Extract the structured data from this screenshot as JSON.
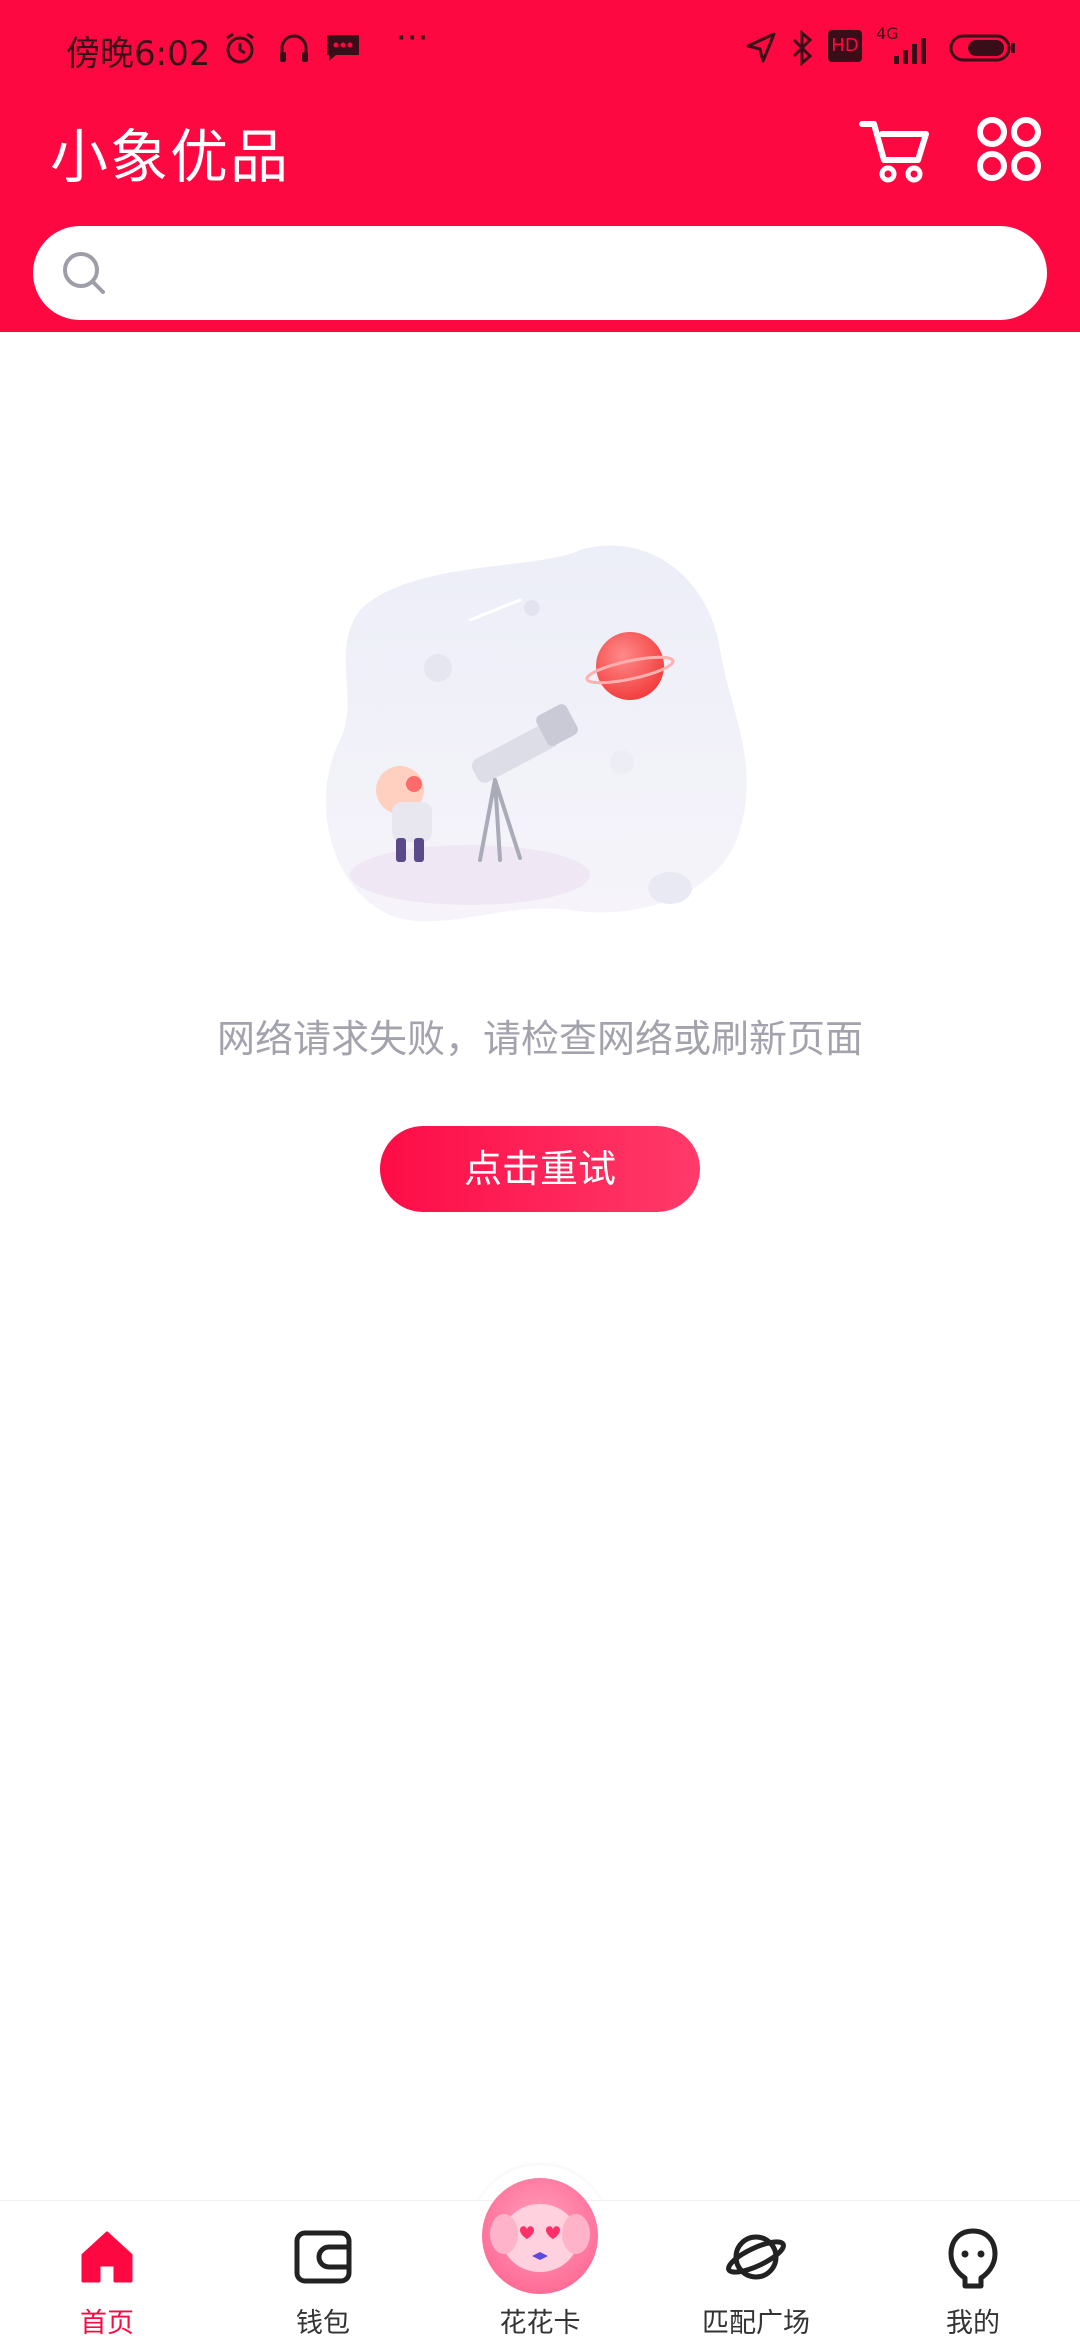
{
  "status_bar": {
    "time": "傍晚6:02",
    "dots": "···",
    "network": "4G",
    "hd": "HD"
  },
  "header": {
    "title": "小象优品",
    "cart_icon": "cart-icon",
    "menu_icon": "grid-menu-icon"
  },
  "search": {
    "placeholder": "",
    "icon": "search-icon"
  },
  "error": {
    "message": "网络请求失败，请检查网络或刷新页面",
    "retry_label": "点击重试"
  },
  "tabs": [
    {
      "label": "首页",
      "icon": "home-icon",
      "active": true
    },
    {
      "label": "钱包",
      "icon": "wallet-icon",
      "active": false
    },
    {
      "label": "花花卡",
      "icon": "mascot-icon",
      "active": false
    },
    {
      "label": "匹配广场",
      "icon": "planet-icon",
      "active": false
    },
    {
      "label": "我的",
      "icon": "profile-icon",
      "active": false
    }
  ],
  "colors": {
    "brand": "#fe0841",
    "text_muted": "#a3a3ad"
  }
}
